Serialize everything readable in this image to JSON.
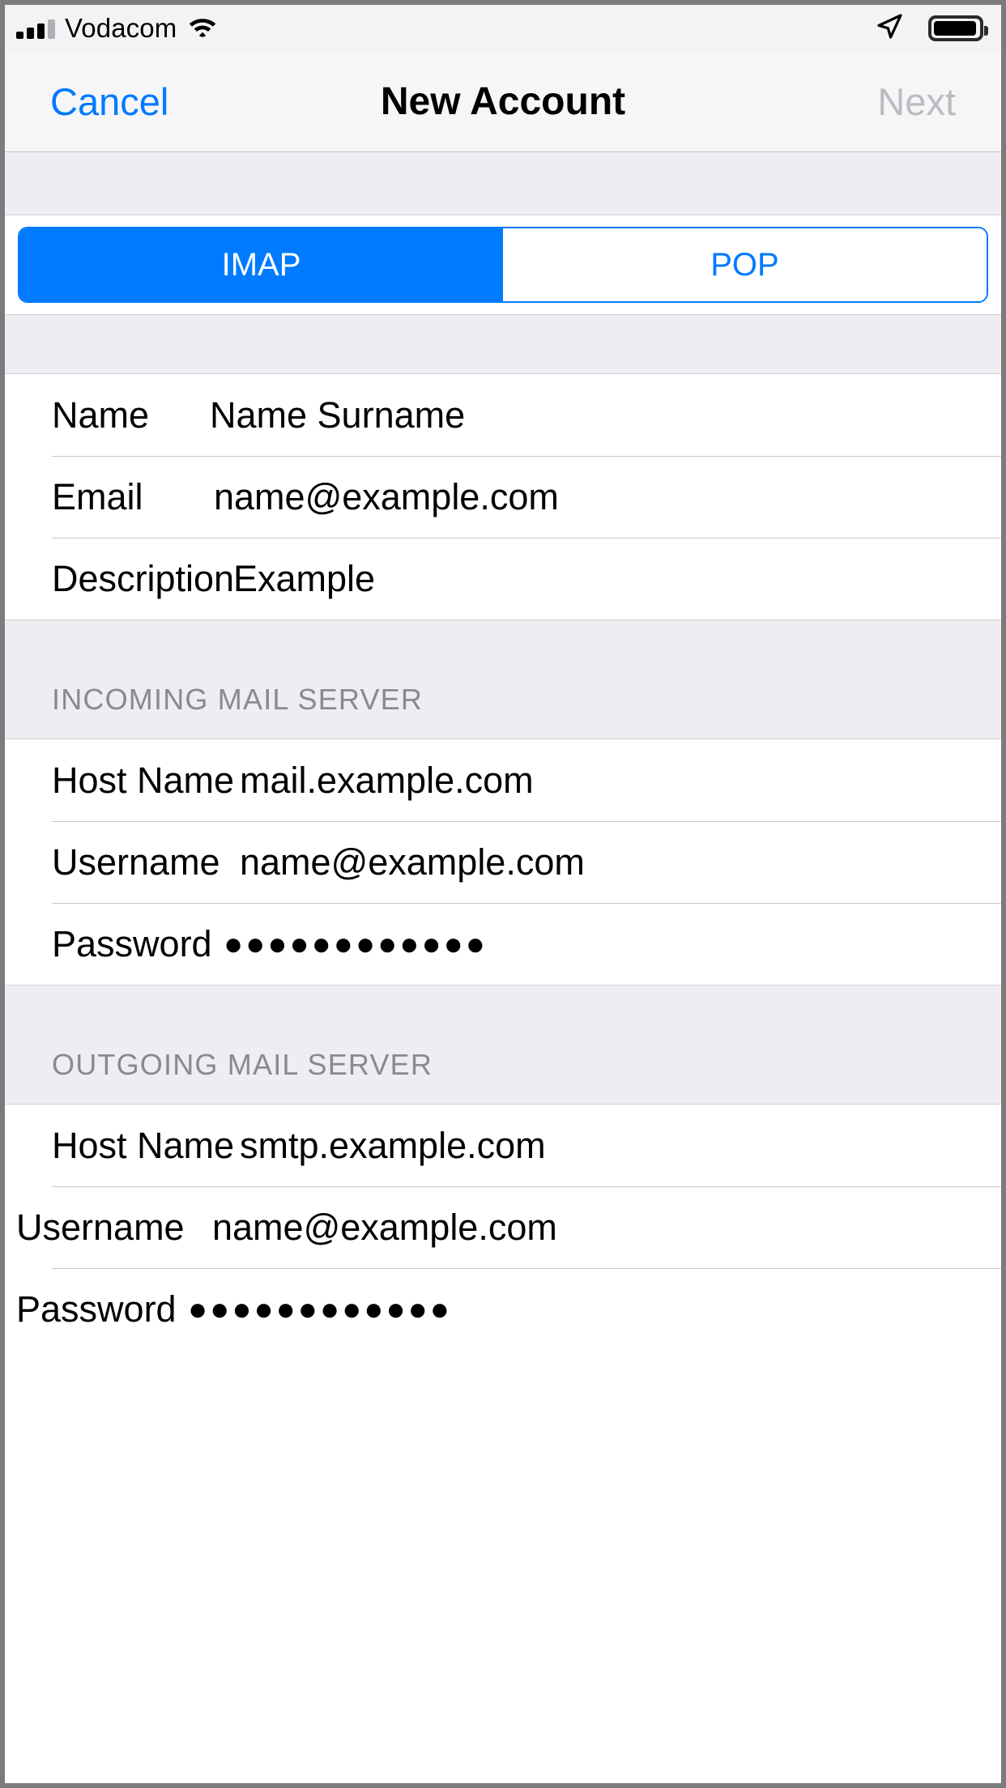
{
  "statusbar": {
    "carrier": "Vodacom",
    "signal_icon": "cellular-signal-icon",
    "wifi_icon": "wifi-icon",
    "location_icon": "location-arrow-icon",
    "battery_icon": "battery-icon"
  },
  "navbar": {
    "cancel_label": "Cancel",
    "title": "New Account",
    "next_label": "Next"
  },
  "segmented_control": {
    "options": [
      "IMAP",
      "POP"
    ],
    "selected": "IMAP",
    "imap_label": "IMAP",
    "pop_label": "POP"
  },
  "account_section": {
    "rows": [
      {
        "label": "Name",
        "value": "Name Surname"
      },
      {
        "label": "Email",
        "value": "name@example.com"
      },
      {
        "label": "Description",
        "value": "Example"
      }
    ]
  },
  "incoming_section": {
    "header": "INCOMING MAIL SERVER",
    "rows": [
      {
        "label": "Host Name",
        "value": "mail.example.com"
      },
      {
        "label": "Username",
        "value": "name@example.com"
      },
      {
        "label": "Password",
        "value": "●●●●●●●●●●●●"
      }
    ]
  },
  "outgoing_section": {
    "header": "OUTGOING MAIL SERVER",
    "rows": [
      {
        "label": "Host Name",
        "value": "smtp.example.com"
      },
      {
        "label": "Username",
        "value": "name@example.com"
      },
      {
        "label": "Password",
        "value": "●●●●●●●●●●●●"
      }
    ]
  },
  "colors": {
    "accent_blue": "#007AFF",
    "disabled_grey": "#BCBCC0",
    "section_grey": "#EEEEF2",
    "header_text_grey": "#8A8A8E",
    "separator": "#C8C7CC"
  }
}
